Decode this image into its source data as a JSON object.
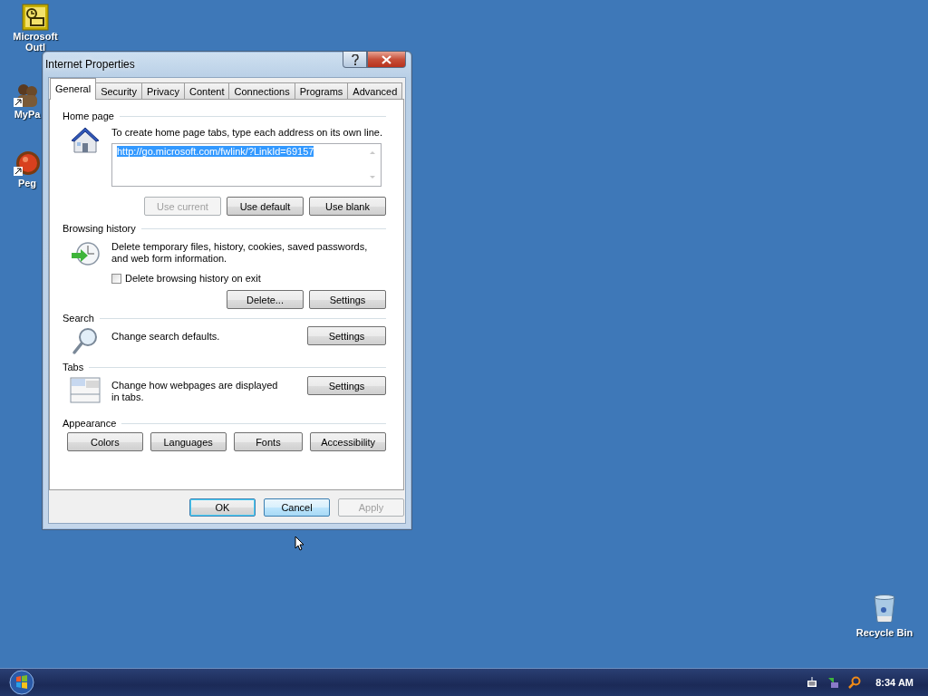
{
  "desktop_icons": [
    {
      "kind": "outlook",
      "label_lines": [
        "Microsoft",
        "Outl"
      ]
    },
    {
      "kind": "people",
      "label_lines": [
        "MyPa"
      ]
    },
    {
      "kind": "ball",
      "label_lines": [
        "Peg"
      ]
    }
  ],
  "recycle_bin": {
    "label": "Recycle Bin"
  },
  "window": {
    "title": "Internet Properties"
  },
  "tabs": [
    {
      "label": "General",
      "selected": true
    },
    {
      "label": "Security",
      "selected": false
    },
    {
      "label": "Privacy",
      "selected": false
    },
    {
      "label": "Content",
      "selected": false
    },
    {
      "label": "Connections",
      "selected": false
    },
    {
      "label": "Programs",
      "selected": false
    },
    {
      "label": "Advanced",
      "selected": false
    }
  ],
  "home_page": {
    "label": "Home page",
    "instruction": "To create home page tabs, type each address on its own line.",
    "value": "http://go.microsoft.com/fwlink/?LinkId=69157",
    "value_highlighted": true,
    "buttons": [
      {
        "label": "Use current",
        "disabled": true
      },
      {
        "label": "Use default",
        "disabled": false
      },
      {
        "label": "Use blank",
        "disabled": false
      }
    ]
  },
  "browsing_history": {
    "label": "Browsing history",
    "description": "Delete temporary files, history, cookies, saved passwords, and web form information.",
    "checkbox": {
      "label": "Delete browsing history on exit",
      "checked": false
    },
    "buttons": [
      {
        "label": "Delete...",
        "disabled": false
      },
      {
        "label": "Settings",
        "disabled": false
      }
    ]
  },
  "search": {
    "label": "Search",
    "description": "Change search defaults.",
    "buttons": [
      {
        "label": "Settings",
        "disabled": false
      }
    ]
  },
  "tabs_section": {
    "label": "Tabs",
    "description": "Change how webpages are displayed in tabs.",
    "buttons": [
      {
        "label": "Settings",
        "disabled": false
      }
    ]
  },
  "appearance": {
    "label": "Appearance",
    "buttons": [
      {
        "label": "Colors",
        "disabled": false
      },
      {
        "label": "Languages",
        "disabled": false
      },
      {
        "label": "Fonts",
        "disabled": false
      },
      {
        "label": "Accessibility",
        "disabled": false
      }
    ]
  },
  "dialog_buttons": [
    {
      "label": "OK",
      "focused": true,
      "hovered": false,
      "disabled": false
    },
    {
      "label": "Cancel",
      "focused": false,
      "hovered": true,
      "disabled": false
    },
    {
      "label": "Apply",
      "focused": false,
      "hovered": false,
      "disabled": true
    }
  ],
  "taskbar": {
    "clock": "8:34 AM"
  }
}
